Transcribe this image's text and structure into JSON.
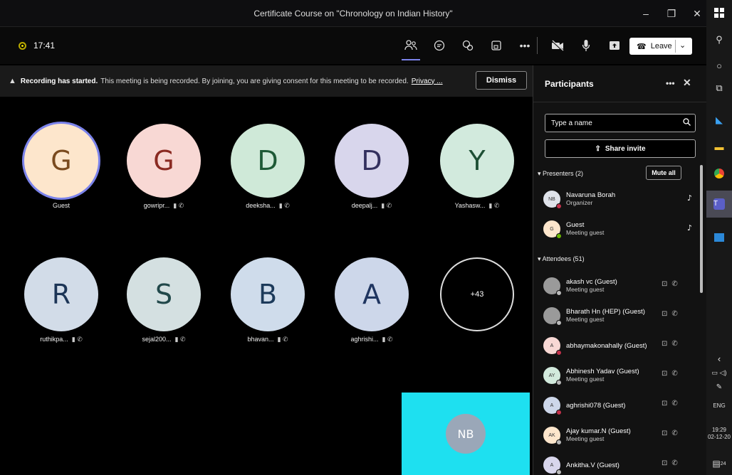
{
  "window": {
    "title": "Certificate Course on \"Chronology on Indian History\"",
    "minimize": "–",
    "maximize": "❐",
    "close": "✕"
  },
  "toolbar": {
    "time": "17:41",
    "leave_label": "Leave"
  },
  "banner": {
    "heading": "Recording has started.",
    "text": "This meeting is being recorded. By joining, you are giving consent for this meeting to be recorded.",
    "link": "Privacy ...",
    "dismiss": "Dismiss"
  },
  "tiles": [
    {
      "initial": "G",
      "name": "Guest",
      "bg": "#fde6cc",
      "fg": "#7a4a1e"
    },
    {
      "initial": "G",
      "name": "gowripr...",
      "bg": "#f8d8d4",
      "fg": "#8a2a22"
    },
    {
      "initial": "D",
      "name": "deeksha...",
      "bg": "#cfe9d8",
      "fg": "#1e5a36"
    },
    {
      "initial": "D",
      "name": "deepalj...",
      "bg": "#d8d6ec",
      "fg": "#33305e"
    },
    {
      "initial": "Y",
      "name": "Yashasw...",
      "bg": "#d2eadd",
      "fg": "#1d4f34"
    },
    {
      "initial": "R",
      "name": "ruthikpa...",
      "bg": "#d2dce8",
      "fg": "#1c3556"
    },
    {
      "initial": "S",
      "name": "sejal200...",
      "bg": "#d4e0e1",
      "fg": "#21484a"
    },
    {
      "initial": "B",
      "name": "bhavan...",
      "bg": "#cfdceb",
      "fg": "#1c3a5a"
    },
    {
      "initial": "A",
      "name": "aghrishi...",
      "bg": "#cdd7ea",
      "fg": "#1f3560"
    }
  ],
  "more_count": "+43",
  "self_view": {
    "initials": "NB"
  },
  "panel": {
    "title": "Participants",
    "search_placeholder": "Type a name",
    "share_invite": "Share invite",
    "presenters_label": "Presenters (2)",
    "mute_all": "Mute all",
    "attendees_label": "Attendees (51)",
    "presenters": [
      {
        "initials": "NB",
        "name": "Navaruna Borah",
        "role": "Organizer",
        "status": "#c4314b",
        "bg": "#dfe3ea"
      },
      {
        "initials": "G",
        "name": "Guest",
        "role": "Meeting guest",
        "status": "#6bb700",
        "bg": "#fde6cc"
      }
    ],
    "attendees": [
      {
        "initials": "",
        "name": "akash vc (Guest)",
        "role": "Meeting guest",
        "status": "#bbbbbb",
        "bg": "#9a9a9a"
      },
      {
        "initials": "",
        "name": "Bharath Hn (HEP) (Guest)",
        "role": "Meeting guest",
        "status": "#bbbbbb",
        "bg": "#9a9a9a"
      },
      {
        "initials": "A",
        "name": "abhaymakonahally (Guest)",
        "role": "",
        "status": "#c4314b",
        "bg": "#f8d8d4"
      },
      {
        "initials": "AY",
        "name": "Abhinesh Yadav (Guest)",
        "role": "Meeting guest",
        "status": "#bbbbbb",
        "bg": "#d2eadd"
      },
      {
        "initials": "A",
        "name": "aghrishi078 (Guest)",
        "role": "",
        "status": "#c4314b",
        "bg": "#cdd7ea"
      },
      {
        "initials": "AK",
        "name": "Ajay kumar.N (Guest)",
        "role": "Meeting guest",
        "status": "#bbbbbb",
        "bg": "#fde6cc"
      },
      {
        "initials": "A",
        "name": "Ankitha.V (Guest)",
        "role": "",
        "status": "#bbbbbb",
        "bg": "#d8d6ec"
      }
    ]
  },
  "taskbar": {
    "lang": "ENG",
    "time": "19:29",
    "date": "02-12-20",
    "badge": "24"
  }
}
